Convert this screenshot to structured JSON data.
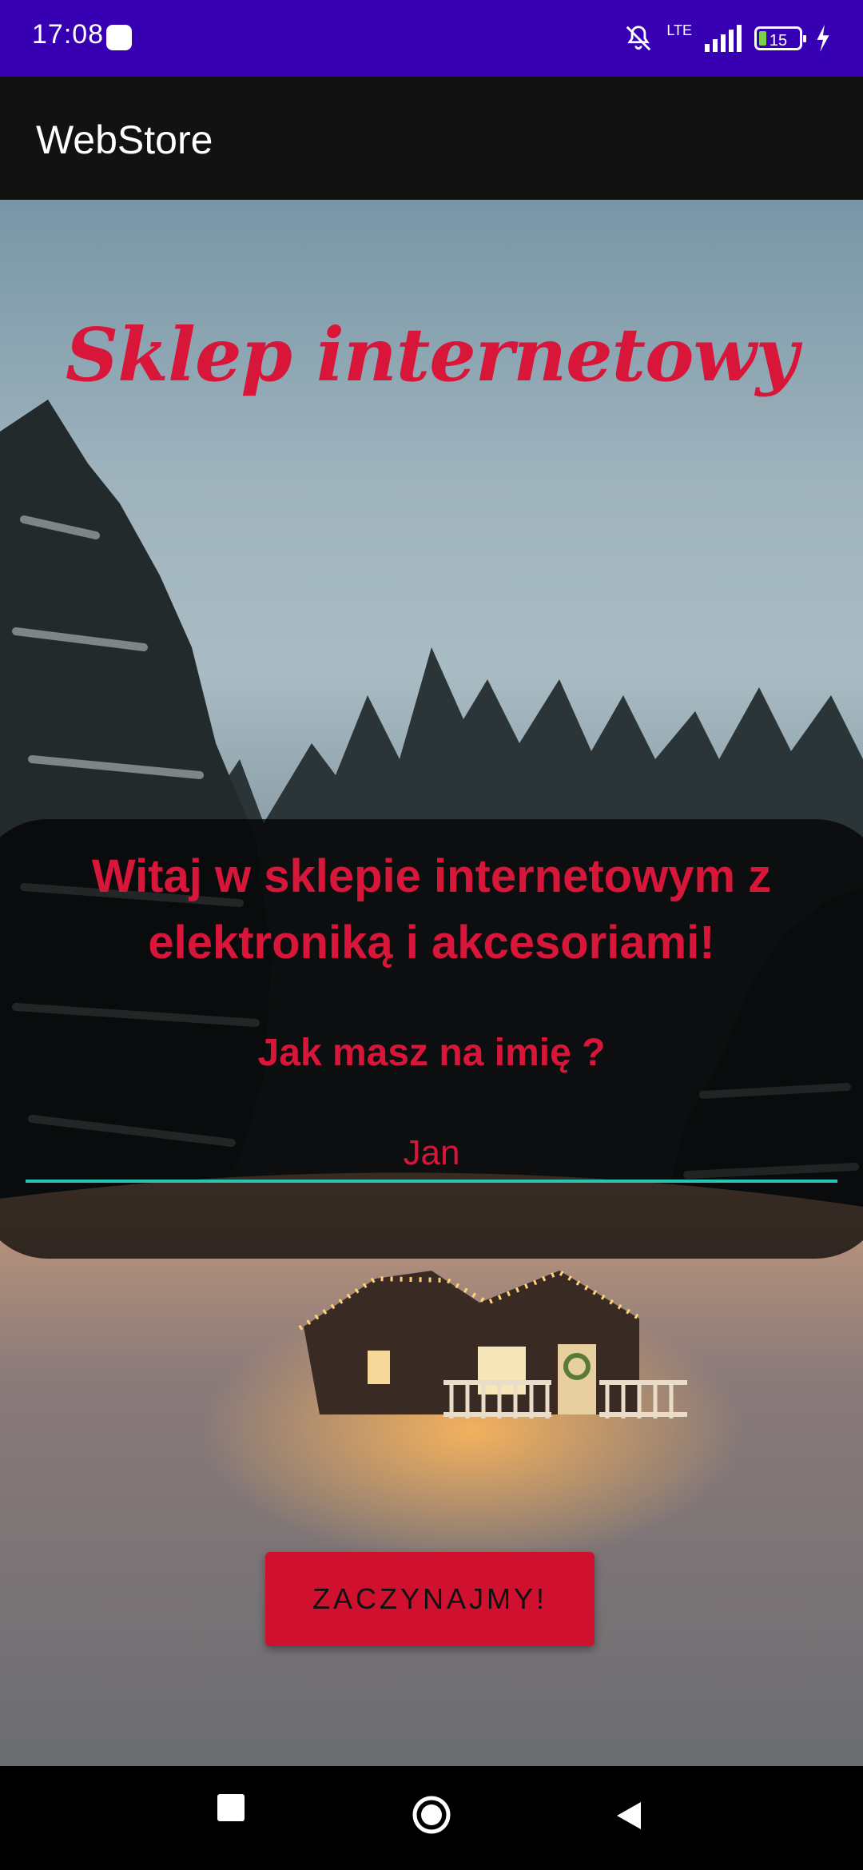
{
  "status_bar": {
    "time": "17:08",
    "network": "LTE",
    "battery": "15",
    "icons": [
      "app-notification-icon",
      "bell-off-icon",
      "signal-icon",
      "battery-icon",
      "charging-icon"
    ]
  },
  "app_bar": {
    "title": "WebStore"
  },
  "store": {
    "title": "Sklep internetowy",
    "welcome": "Witaj w sklepie internetowym z elektroniką i akcesoriami!",
    "name_question": "Jak masz na imię ?",
    "name_value": "Jan",
    "start_button": "ZACZYNAJMY!"
  },
  "nav_bar": {
    "icons": [
      "recent-apps-icon",
      "home-icon",
      "back-icon"
    ]
  },
  "colors": {
    "status_bar": "#3700b3",
    "app_bar": "#121212",
    "accent_red": "#d8163a",
    "input_underline": "#26c6b3"
  }
}
